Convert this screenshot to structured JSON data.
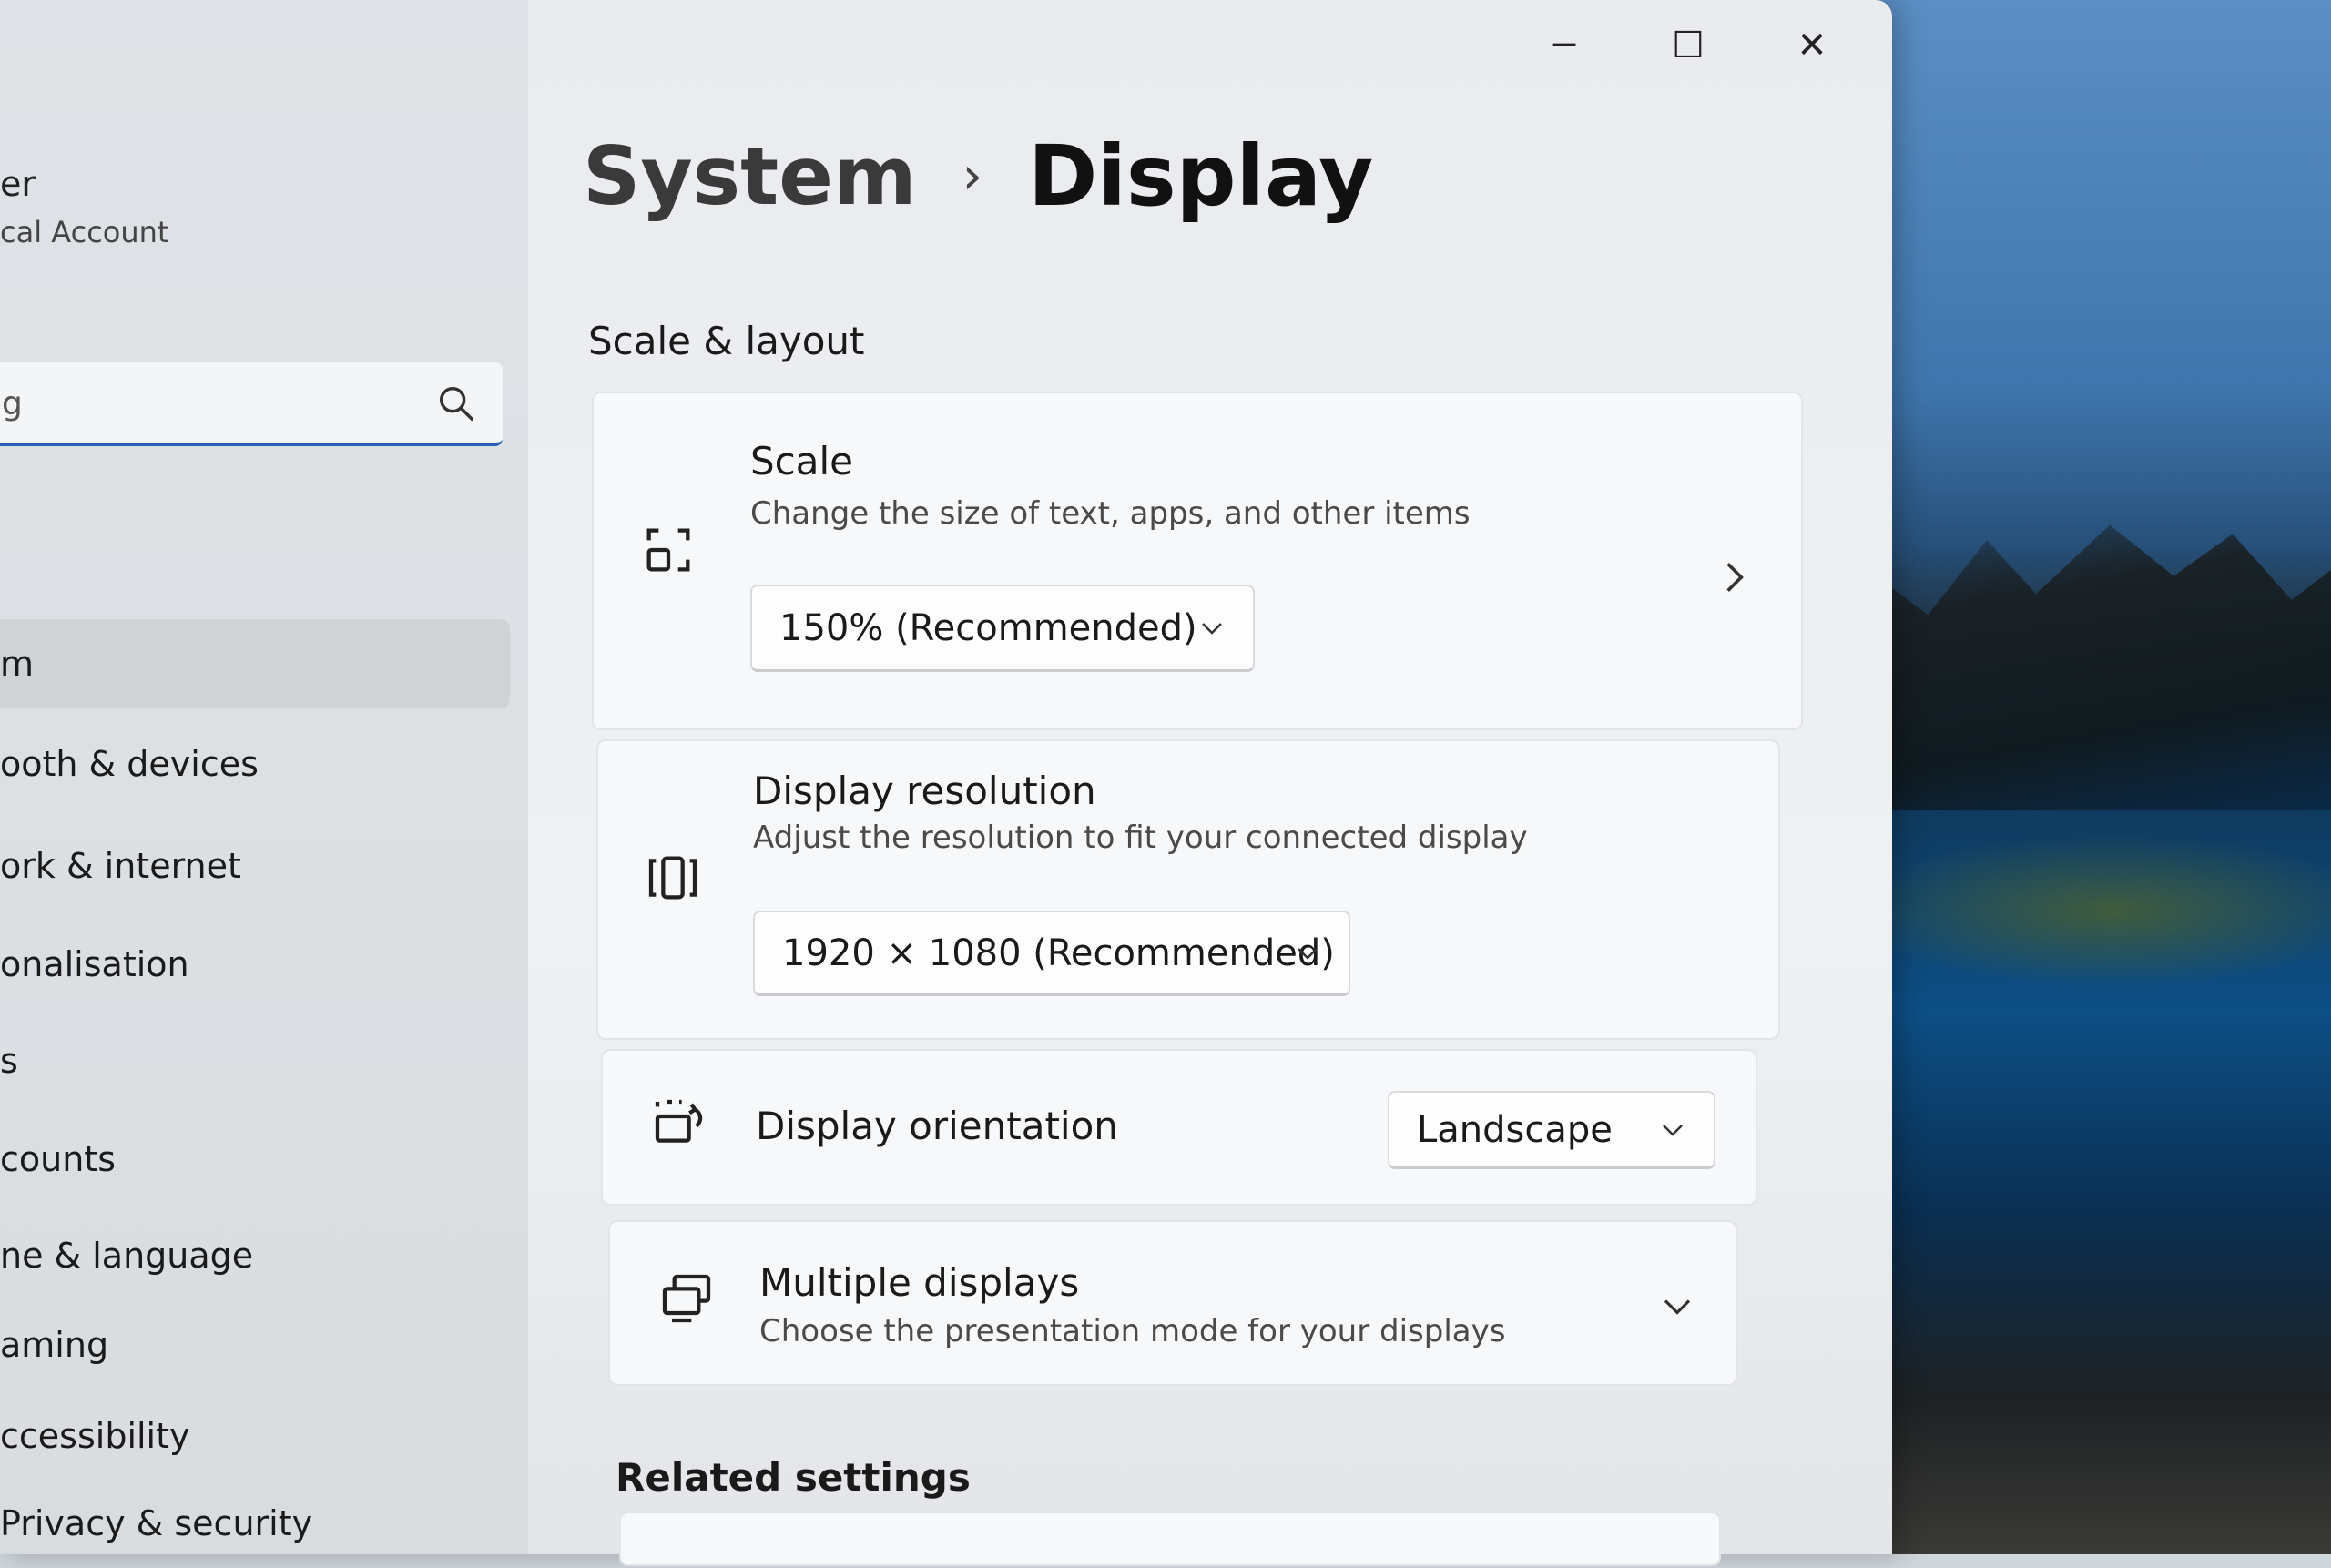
{
  "window": {
    "minimize_label": "─",
    "maximize_label": "☐",
    "close_label": "✕"
  },
  "user": {
    "name": "er",
    "account_type": "cal Account"
  },
  "search": {
    "value": "g"
  },
  "sidebar": {
    "items": [
      {
        "label": "m",
        "selected": true
      },
      {
        "label": "ooth & devices",
        "selected": false
      },
      {
        "label": "ork & internet",
        "selected": false
      },
      {
        "label": "onalisation",
        "selected": false
      },
      {
        "label": "s",
        "selected": false
      },
      {
        "label": "counts",
        "selected": false
      },
      {
        "label": "ne & language",
        "selected": false
      },
      {
        "label": "aming",
        "selected": false
      },
      {
        "label": "ccessibility",
        "selected": false
      },
      {
        "label": "Privacy & security",
        "selected": false
      }
    ]
  },
  "breadcrumb": {
    "parent": "System",
    "separator": "›",
    "current": "Display"
  },
  "sections": {
    "scale_layout": "Scale & layout",
    "related": "Related settings"
  },
  "cards": {
    "scale": {
      "title": "Scale",
      "description": "Change the size of text, apps, and other items",
      "value": "150% (Recommended)",
      "icon": "scale-icon"
    },
    "resolution": {
      "title": "Display resolution",
      "description": "Adjust the resolution to fit your connected display",
      "value": "1920 × 1080 (Recommended)",
      "icon": "resolution-icon"
    },
    "orientation": {
      "title": "Display orientation",
      "value": "Landscape",
      "icon": "orientation-icon"
    },
    "multiple": {
      "title": "Multiple displays",
      "description": "Choose the presentation mode for your displays",
      "icon": "multiple-displays-icon"
    }
  },
  "colors": {
    "accent": "#2b5fb3",
    "card_bg": "#f7f8f9",
    "window_bg": "#eceef0"
  }
}
